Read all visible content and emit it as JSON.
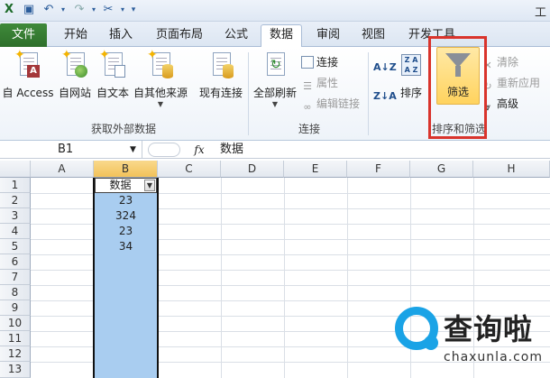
{
  "window": {
    "title_partial": "工"
  },
  "quick_access": {
    "icons": [
      "save-icon",
      "undo-icon",
      "redo-icon",
      "tool-icon",
      "customize-icon"
    ]
  },
  "tabs": [
    {
      "label": "文件"
    },
    {
      "label": "开始"
    },
    {
      "label": "插入"
    },
    {
      "label": "页面布局"
    },
    {
      "label": "公式"
    },
    {
      "label": "数据"
    },
    {
      "label": "审阅"
    },
    {
      "label": "视图"
    },
    {
      "label": "开发工具"
    }
  ],
  "ribbon": {
    "external": {
      "access": "自 Access",
      "web": "自网站",
      "text": "自文本",
      "other": "自其他来源",
      "existing": "现有连接",
      "group_label": "获取外部数据"
    },
    "connections": {
      "refresh_all": "全部刷新",
      "connections": "连接",
      "properties": "属性",
      "edit_links": "编辑链接",
      "group_label": "连接"
    },
    "sort_filter": {
      "sort_az": "A↓Z",
      "sort_za": "Z↓A",
      "sort": "排序",
      "filter": "筛选",
      "clear": "清除",
      "reapply": "重新应用",
      "advanced": "高级",
      "group_label": "排序和筛选"
    }
  },
  "formula_bar": {
    "name_box": "B1",
    "fx": "fx",
    "value": "数据"
  },
  "grid": {
    "columns": [
      "A",
      "B",
      "C",
      "D",
      "E",
      "F",
      "G",
      "H"
    ],
    "rows": [
      "1",
      "2",
      "3",
      "4",
      "5",
      "6",
      "7",
      "8",
      "9",
      "10",
      "11",
      "12",
      "13"
    ],
    "colB": [
      "数据",
      "23",
      "324",
      "23",
      "34"
    ]
  },
  "watermark": {
    "cn": "查询啦",
    "en": "chaxunla.com"
  },
  "colors": {
    "file_tab": "#2e6f2b",
    "selection": "#a9cdf0",
    "highlight": "#d9342c",
    "filter_active": "#ffd35e"
  }
}
